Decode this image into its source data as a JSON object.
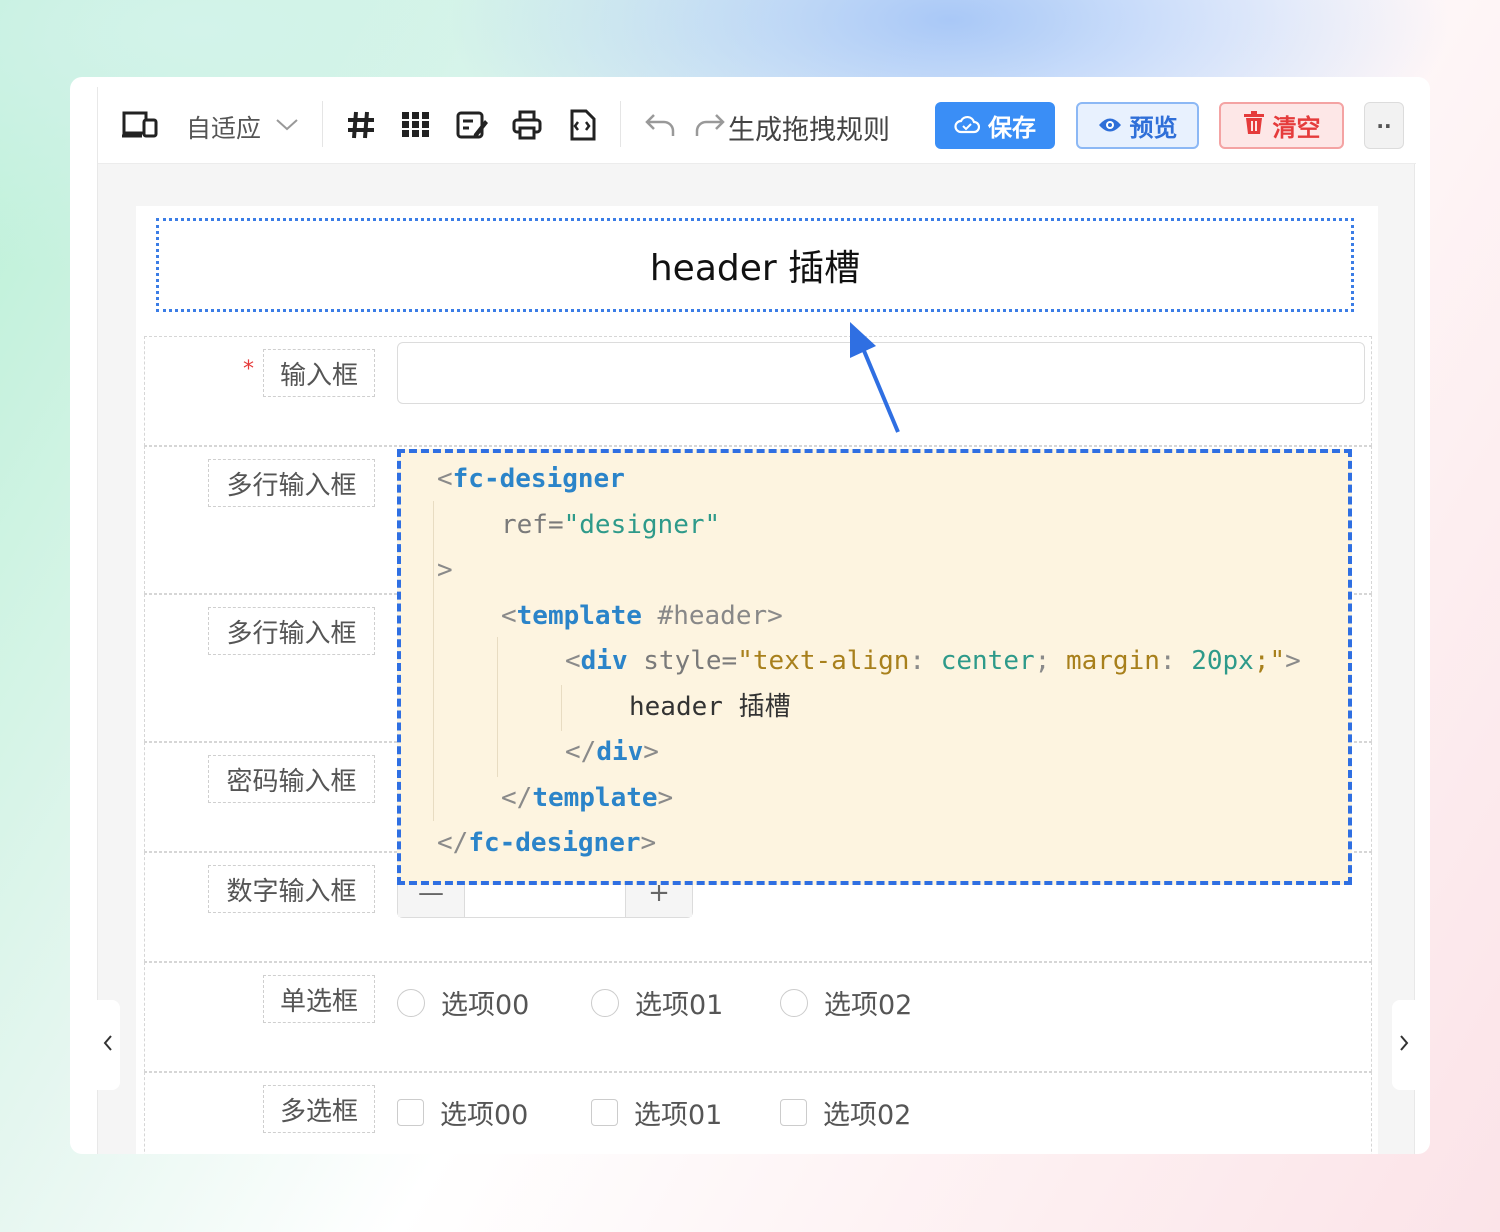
{
  "toolbar": {
    "device_mode": "自适应",
    "rule_label": "生成拖拽规则",
    "save_label": "保存",
    "preview_label": "预览",
    "clear_label": "清空",
    "more_label": "··"
  },
  "canvas": {
    "header_slot": "header 插槽",
    "fields": [
      {
        "label": "输入框",
        "required": "*"
      },
      {
        "label": "多行输入框"
      },
      {
        "label": "多行输入框"
      },
      {
        "label": "密码输入框"
      },
      {
        "label": "数字输入框"
      },
      {
        "label": "单选框",
        "options": [
          "选项00",
          "选项01",
          "选项02"
        ]
      },
      {
        "label": "多选框",
        "options": [
          "选项00",
          "选项01",
          "选项02"
        ]
      }
    ],
    "stepper_minus": "—",
    "stepper_plus": "+"
  },
  "code": {
    "l1_tag": "fc-designer",
    "l2_attr": "ref=",
    "l2_val": "\"designer\"",
    "l4_tag": "template",
    "l4_attr": "#header",
    "l5_tag": "div",
    "l5_attr": "style=",
    "l5_q1": "\"",
    "l5_prop1": "text-align",
    "l5_val1": "center",
    "l5_prop2": "margin",
    "l5_val2": "20px",
    "l5_q2": ";\"",
    "l6_text": "header 插槽",
    "l7_tag": "div",
    "l8_tag": "template",
    "l9_tag": "fc-designer"
  },
  "colors": {
    "accent": "#3a8ef6",
    "danger": "#e53b3b",
    "code_bg": "#fdf4e0",
    "slot_border": "#3b7de6"
  }
}
